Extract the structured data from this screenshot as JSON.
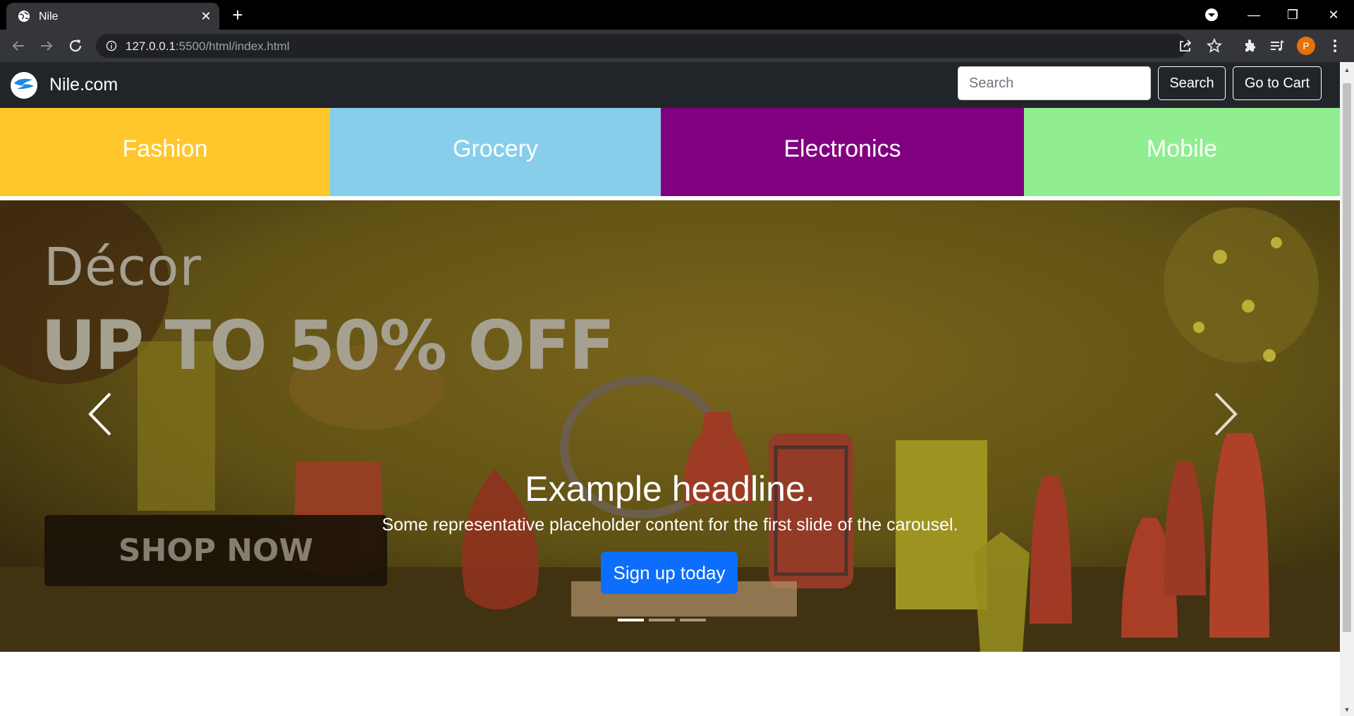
{
  "browser": {
    "tab_title": "Nile",
    "tab_close": "✕",
    "new_tab": "+",
    "url_host": "127.0.0.1",
    "url_rest": ":5500/html/index.html",
    "profile_initial": "P",
    "window_controls": {
      "minimize": "—",
      "restore": "❐",
      "close": "✕"
    },
    "icons": [
      "back-icon",
      "forward-icon",
      "reload-icon",
      "site-info-icon",
      "share-icon",
      "star-icon",
      "extensions-icon",
      "reading-list-icon",
      "menu-icon",
      "media-icon"
    ]
  },
  "navbar": {
    "brand": "Nile.com",
    "search_placeholder": "Search",
    "search_button": "Search",
    "cart_button": "Go to Cart"
  },
  "categories": [
    {
      "label": "Fashion",
      "color": "#ffc72c"
    },
    {
      "label": "Grocery",
      "color": "#87ceeb"
    },
    {
      "label": "Electronics",
      "color": "#800080"
    },
    {
      "label": "Mobile",
      "color": "#90ee90"
    }
  ],
  "carousel": {
    "banner_title": "Décor",
    "banner_offer": "UP TO 50% OFF",
    "banner_button": "SHOP NOW",
    "caption_title": "Example headline.",
    "caption_text": "Some representative placeholder content for the first slide of the carousel.",
    "caption_button": "Sign up today",
    "slide_count": 3,
    "active_slide": 1
  },
  "colors": {
    "navbar_bg": "#212529",
    "primary": "#0d6efd",
    "banner_bg": "#6b5a16"
  }
}
